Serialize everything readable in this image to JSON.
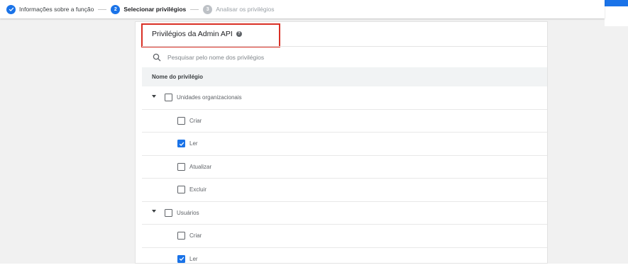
{
  "stepper": {
    "steps": [
      {
        "number": "",
        "label": "Informações sobre a função",
        "state": "done"
      },
      {
        "number": "2",
        "label": "Selecionar privilégios",
        "state": "active"
      },
      {
        "number": "3",
        "label": "Analisar os privilégios",
        "state": "pending"
      }
    ]
  },
  "card": {
    "title": "Privilégios da Admin API",
    "help_icon": "help-icon",
    "search_placeholder": "Pesquisar pelo nome dos privilégios",
    "column_header": "Nome do privilégio",
    "groups": [
      {
        "label": "Unidades organizacionais",
        "expanded": true,
        "checked": false,
        "items": [
          {
            "label": "Criar",
            "checked": false
          },
          {
            "label": "Ler",
            "checked": true
          },
          {
            "label": "Atualizar",
            "checked": false
          },
          {
            "label": "Excluir",
            "checked": false
          }
        ]
      },
      {
        "label": "Usuários",
        "expanded": true,
        "checked": false,
        "items": [
          {
            "label": "Criar",
            "checked": false
          },
          {
            "label": "Ler",
            "checked": true
          }
        ]
      }
    ]
  },
  "colors": {
    "accent": "#1a73e8",
    "highlight": "#d93025"
  }
}
